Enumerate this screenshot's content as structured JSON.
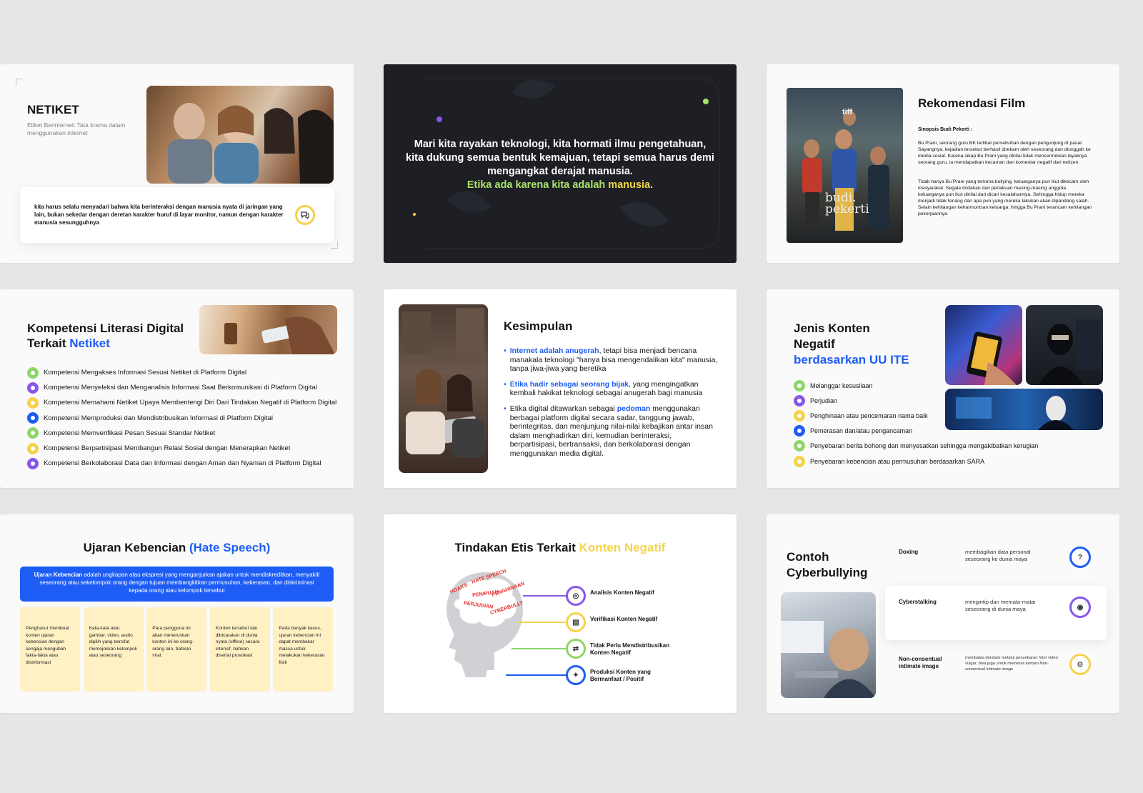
{
  "colors": {
    "background": "#e6e6e6",
    "accent_blue": "#1d5cf5",
    "accent_yellow": "#f5d549",
    "accent_green": "#a9e36a",
    "accent_purple": "#8758e8",
    "dark_slide": "#1d1f24"
  },
  "s1": {
    "title": "NETIKET",
    "subtitle": "Etiket Berinternet: Tata krama dalam menggunakan internet",
    "body": "kita harus selalu menyadari bahwa kita berinteraksi dengan manusia nyata di jaringan yang lain, bukan sekedar dengan deretan karakter huruf di layar monitor, namun dengan karakter manusia sesungguhnya",
    "icon": "chat-icon"
  },
  "s2": {
    "quote": "Mari kita rayakan teknologi, kita hormati ilmu pengetahuan, kita dukung semua bentuk kemajuan, tetapi semua harus demi mengangkat derajat manusia.",
    "highlight_a": "Etika ada karena kita adalah",
    "highlight_b": "manusia."
  },
  "s3": {
    "title": "Rekomendasi Film",
    "synopsis_label": "Sinopsis Budi Pekerti :",
    "p1": "Bu Prani, seorang guru BK terlibat perselisihan dengan pengunjung di pasar. Sayangnya, kejadian tersebut berhasil direkam oleh seseorang dan diunggah ke media sosial. Karena sikap Bu Prani yang dinilai tidak mencerminkan layaknya seorang guru, ia mendapatkan kecaman dan komentar negatif dari netizen.",
    "p2": "Tidak hanya Bu Prani yang terkena bullying, keluarganya pun ikut dikecam oleh masyarakat. Segala tindakan dan perlakuan masing-masing anggota keluarganya pun ikut dinilai dari dicari kesalahannya. Sehingga hidup mereka menjadi tidak tenang dan apa pun yang mereka lakukan akan dipandang salah. Selain kehilangan keharmonisan keluarga, hingga Bu Prani terancam kehilangan pekerjaannya.",
    "poster_badge": "tiff",
    "poster_title_1": "budi.",
    "poster_title_2": "pekerti"
  },
  "s4": {
    "title_a": "Kompetensi Literasi Digital",
    "title_b": "Terkait",
    "title_c": "Netiket",
    "items": [
      {
        "label": "Kompetensi Mengakses Informasi Sesuai Netiket di Platform Digital",
        "color": "green"
      },
      {
        "label": "Kompetensi Menyeleksi dan Menganalisis Informasi Saat Berkomunikasi di Platform Digital",
        "color": "purple"
      },
      {
        "label": "Kompetensi Memahami Netiket Upaya Membentengi Diri Dari Tindakan Negatif di Platform Digital",
        "color": "yellow"
      },
      {
        "label": "Kompetensi Memproduksi dan Mendistribusikan Informasi di Platform Digital",
        "color": "blue"
      },
      {
        "label": "Kompetensi Memverifikasi Pesan Sesuai Standar Netiket",
        "color": "green"
      },
      {
        "label": "Kompetensi Berpartisipasi Membangun Relasi Sosial dengan Menerapkan Netiket",
        "color": "yellow"
      },
      {
        "label": "Kompetensi Berkolaborasi Data dan Informasi dengan Aman dan Nyaman di Platform Digital",
        "color": "purple"
      }
    ]
  },
  "s5": {
    "title": "Kesimpulan",
    "b1_hl": "Internet adalah anugerah",
    "b1_rest": ", tetapi bisa menjadi bencana manakala teknologi \"hanya bisa mengendalikan kita\" manusia, tanpa jiwa-jiwa yang beretika",
    "b2_hl": "Etika hadir sebagai seorang bijak",
    "b2_rest": ", yang mengingatkan kembali hakikat teknologi sebagai anugerah bagi manusia",
    "b3_pre": "Etika digital ditawarkan sebagai ",
    "b3_hl": "pedoman",
    "b3_rest": " menggunakan berbagai platform digital secara sadar, tanggung jawab, berintegritas, dan menjunjung nilai-nilai kebajikan antar insan dalam menghadirkan diri, kemudian berinteraksi, berpartisipasi, bertransaksi, dan berkolaborasi dengan menggunakan media digital."
  },
  "s6": {
    "title_a": "Jenis Konten",
    "title_b": "Negatif",
    "title_c": "berdasarkan UU ITE",
    "items": [
      {
        "label": "Melanggar kesusilaan",
        "color": "green"
      },
      {
        "label": "Perjudian",
        "color": "purple"
      },
      {
        "label": "Penghinaan atau pencemaran nama baik",
        "color": "yellow"
      },
      {
        "label": "Pemerasan dan/atau pengancaman",
        "color": "blue"
      },
      {
        "label": "Penyebaran berita bohong dan menyesatkan sehingga mengakibatkan kerugian",
        "color": "green"
      },
      {
        "label": "Penyebaran kebencian atau permusuhan berdasarkan SARA",
        "color": "yellow"
      }
    ]
  },
  "s7": {
    "title_a": "Ujaran Kebencian",
    "title_b": "(Hate Speech)",
    "def_bold": "Ujaran Kebencian",
    "def_rest": " adalah ungkapan atau ekspresi yang menganjurkan ajakan untuk mendiskreditkan, menyakiti seseorang atau sekelompok orang dengan tujuan membangkitkan permusuhan, kekerasan, dan diskriminasi kepada orang atau kelompok tersebut",
    "cards": [
      "Penghasut membuat konten ujaran kebencian dengan sengaja mengubah fakta-fakta atau disinformasi",
      "Kata-kata atau gambar, video, audio dipilih yang bersifat memojokkan kelompok atau seseorang",
      "Para pengguna ini akan meneruskan konten ini ke orang-orang lain, bahkan viral.",
      "Konten tersebut lalu dibicarakan di dunia nyata (offline) secara intensif, bahkan disertai provokasi",
      "Pada banyak kasus, ujaran kebencian ini dapat membakar massa untuk melakukan kekerasan fisik"
    ]
  },
  "s8": {
    "title_a": "Tindakan Etis Terkait",
    "title_b": "Konten Negatif",
    "words": [
      "HATE SPEECH",
      "HOAKS",
      "PENIPUAN",
      "PENGHINAAN",
      "PERJUDIAN",
      "CYBERBULLY"
    ],
    "items": [
      {
        "label": "Analisis Konten Negatif",
        "color": "#8758e8",
        "icon": "target-icon"
      },
      {
        "label": "Verifikasi Konten Negatif",
        "color": "#f6d24a",
        "icon": "clipboard-icon"
      },
      {
        "label": "Tidak Perlu Mendistribusikan Konten Negatif",
        "color": "#8ed66a",
        "icon": "share-icon"
      },
      {
        "label": "Produksi Konten yang Bermanfaat / Positif",
        "color": "#1d5cf5",
        "icon": "bulb-icon"
      }
    ]
  },
  "s9": {
    "title": "Contoh Cyberbullying",
    "rows": [
      {
        "term": "Doxing",
        "desc": "membagikan data personal seseorang ke dunia maya",
        "color": "#1d5cf5",
        "icon": "question-icon"
      },
      {
        "term": "Cyberstalking",
        "desc": "mengintip dan memata-matai seseorang di dunia maya",
        "color": "#8758e8",
        "icon": "eye-icon"
      },
      {
        "term": "Non-consentual intimate image",
        "desc": "membalas dendam melalui penyebaran foto/ video vulgar, bisa juga untuk memeras korban Non-consentual intimate image",
        "color": "#f6d24a",
        "icon": "lock-icon"
      }
    ]
  }
}
